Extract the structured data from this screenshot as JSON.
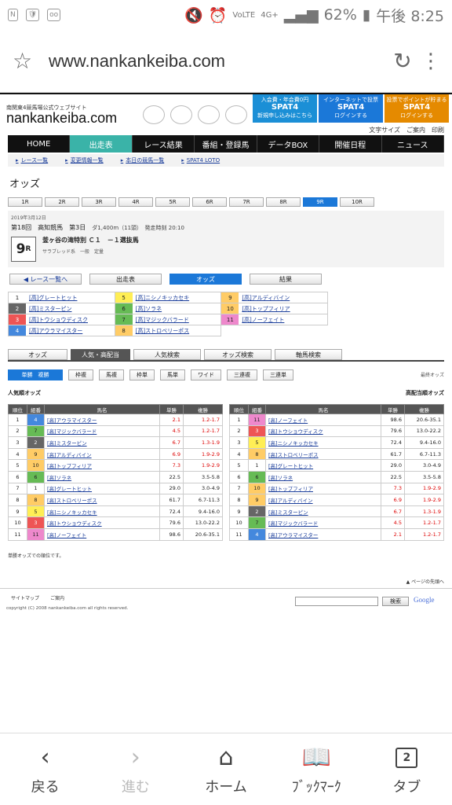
{
  "status": {
    "left": [
      "N",
      "🛡",
      "oo"
    ],
    "signal": "4G+",
    "battery": "62%",
    "time": "午後 8:25",
    "volte": "VoLTE"
  },
  "browser": {
    "url": "www.nankankeiba.com"
  },
  "site": {
    "brand_sub": "南関東4競馬場公式ウェブサイト",
    "brand": "nankankeiba.com",
    "logos": [
      "大井",
      "川崎",
      "船橋",
      "浦和"
    ],
    "ads": [
      {
        "top": "入会費・年会費0円",
        "main": "SPAT4",
        "bottom": "新規申し込みはこちら",
        "color": "#1b8fd6"
      },
      {
        "top": "インターネットで投票",
        "main": "SPAT4",
        "bottom": "ログインする",
        "color": "#1b78d8"
      },
      {
        "top": "投票でポイントが貯まる",
        "main": "SPAT4",
        "bottom": "ログインする",
        "color": "#e58a00"
      }
    ],
    "tools": [
      "文字サイズ",
      "ご案内",
      "印刷"
    ],
    "gnav": [
      "HOME",
      "出走表",
      "レース結果",
      "番組・登録馬",
      "データBOX",
      "開催日程",
      "ニュース"
    ],
    "subnav": [
      "レース一覧",
      "変更情報一覧",
      "本日の競馬一覧",
      "SPAT4 LOTO"
    ]
  },
  "odds_title": "オッズ",
  "race_tabs": [
    "1R",
    "2R",
    "3R",
    "4R",
    "5R",
    "6R",
    "7R",
    "8R",
    "9R",
    "10R"
  ],
  "race": {
    "date": "2019年3月12日",
    "line": "第18回　高知競馬　第3日",
    "dist": "ダ1,400m（11頭）　発走時刻 20:10",
    "num": "9",
    "num_suffix": "R",
    "name": "釜ヶ谷の滝特別 Ｃ１　－１選抜馬",
    "cls": "サラブレッド系　一般　定量"
  },
  "buttons": [
    "レース一覧へ",
    "出走表",
    "オッズ",
    "結果"
  ],
  "horses": [
    {
      "num": "1",
      "name": "[高]グレートヒット",
      "bg": "#fff",
      "fg": "#222"
    },
    {
      "num": "5",
      "name": "[高]ニシノキッカセキ",
      "bg": "#ffee55",
      "fg": "#222"
    },
    {
      "num": "9",
      "name": "[高]アルディバイン",
      "bg": "#ffcc66",
      "fg": "#222"
    },
    {
      "num": "2",
      "name": "[高]ミスターピン",
      "bg": "#666",
      "fg": "#fff"
    },
    {
      "num": "6",
      "name": "[高]ソラネ",
      "bg": "#66bb55",
      "fg": "#222"
    },
    {
      "num": "10",
      "name": "[高]トップフィリア",
      "bg": "#ffcc66",
      "fg": "#222"
    },
    {
      "num": "3",
      "name": "[高]トウショウディスク",
      "bg": "#ee5555",
      "fg": "#fff"
    },
    {
      "num": "7",
      "name": "[高]マジックバラード",
      "bg": "#66bb55",
      "fg": "#222"
    },
    {
      "num": "11",
      "name": "[高]ノーフェイト",
      "bg": "#ee88cc",
      "fg": "#222"
    },
    {
      "num": "4",
      "name": "[高]アウラマイスター",
      "bg": "#4488dd",
      "fg": "#fff"
    },
    {
      "num": "8",
      "name": "[高]ストロベリーポス",
      "bg": "#ffcc66",
      "fg": "#222"
    }
  ],
  "odds_tabs": [
    "オッズ",
    "人気・高配当",
    "人気検索",
    "オッズ検索",
    "軸馬検索"
  ],
  "bet_tabs": [
    "単勝　複勝",
    "枠複",
    "馬複",
    "枠単",
    "馬単",
    "ワイド",
    "三連複",
    "三連単"
  ],
  "last_update": "最終オッズ",
  "pop_title": "人気順オッズ",
  "high_title": "高配当順オッズ",
  "table_headers": [
    "順位",
    "組番",
    "馬名",
    "単勝",
    "複勝"
  ],
  "popular": [
    [
      "1",
      "4",
      "[高]アウラマイスター",
      "2.1",
      "1.2-1.7"
    ],
    [
      "2",
      "7",
      "[高]マジックバラード",
      "4.5",
      "1.2-1.7"
    ],
    [
      "3",
      "2",
      "[高]ミスターピン",
      "6.7",
      "1.3-1.9"
    ],
    [
      "4",
      "9",
      "[高]アルディバイン",
      "6.9",
      "1.9-2.9"
    ],
    [
      "5",
      "10",
      "[高]トップフィリア",
      "7.3",
      "1.9-2.9"
    ],
    [
      "6",
      "6",
      "[高]ソラネ",
      "22.5",
      "3.5-5.8"
    ],
    [
      "7",
      "1",
      "[高]グレートヒット",
      "29.0",
      "3.0-4.9"
    ],
    [
      "8",
      "8",
      "[高]ストロベリーポス",
      "61.7",
      "6.7-11.3"
    ],
    [
      "9",
      "5",
      "[高]ニシノキッカセキ",
      "72.4",
      "9.4-16.0"
    ],
    [
      "10",
      "3",
      "[高]トウショウディスク",
      "79.6",
      "13.0-22.2"
    ],
    [
      "11",
      "11",
      "[高]ノーフェイト",
      "98.6",
      "20.6-35.1"
    ]
  ],
  "high": [
    [
      "1",
      "11",
      "[高]ノーフェイト",
      "98.6",
      "20.6-35.1"
    ],
    [
      "2",
      "3",
      "[高]トウショウディスク",
      "79.6",
      "13.0-22.2"
    ],
    [
      "3",
      "5",
      "[高]ニシノキッカセキ",
      "72.4",
      "9.4-16.0"
    ],
    [
      "4",
      "8",
      "[高]ストロベリーポス",
      "61.7",
      "6.7-11.3"
    ],
    [
      "5",
      "1",
      "[高]グレートヒット",
      "29.0",
      "3.0-4.9"
    ],
    [
      "6",
      "6",
      "[高]ソラネ",
      "22.5",
      "3.5-5.8"
    ],
    [
      "7",
      "10",
      "[高]トップフィリア",
      "7.3",
      "1.9-2.9"
    ],
    [
      "8",
      "9",
      "[高]アルディバイン",
      "6.9",
      "1.9-2.9"
    ],
    [
      "9",
      "2",
      "[高]ミスターピン",
      "6.7",
      "1.3-1.9"
    ],
    [
      "10",
      "7",
      "[高]マジックバラード",
      "4.5",
      "1.2-1.7"
    ],
    [
      "11",
      "4",
      "[高]アウラマイスター",
      "2.1",
      "1.2-1.7"
    ]
  ],
  "note": "単勝オッズでの順位です。",
  "pagetop": "ページの先頭へ",
  "footer": {
    "links": [
      "サイトマップ",
      "ご案内"
    ],
    "copy": "copyright (C) 2008 nankankeiba.com all rights reserved.",
    "search_btn": "検索",
    "google": "Google"
  },
  "nav": {
    "back": "戻る",
    "forward": "進む",
    "home": "ホーム",
    "bookmarks": "ﾌﾞｯｸﾏｰｸ",
    "tabs": "タブ",
    "tab_count": "2"
  }
}
